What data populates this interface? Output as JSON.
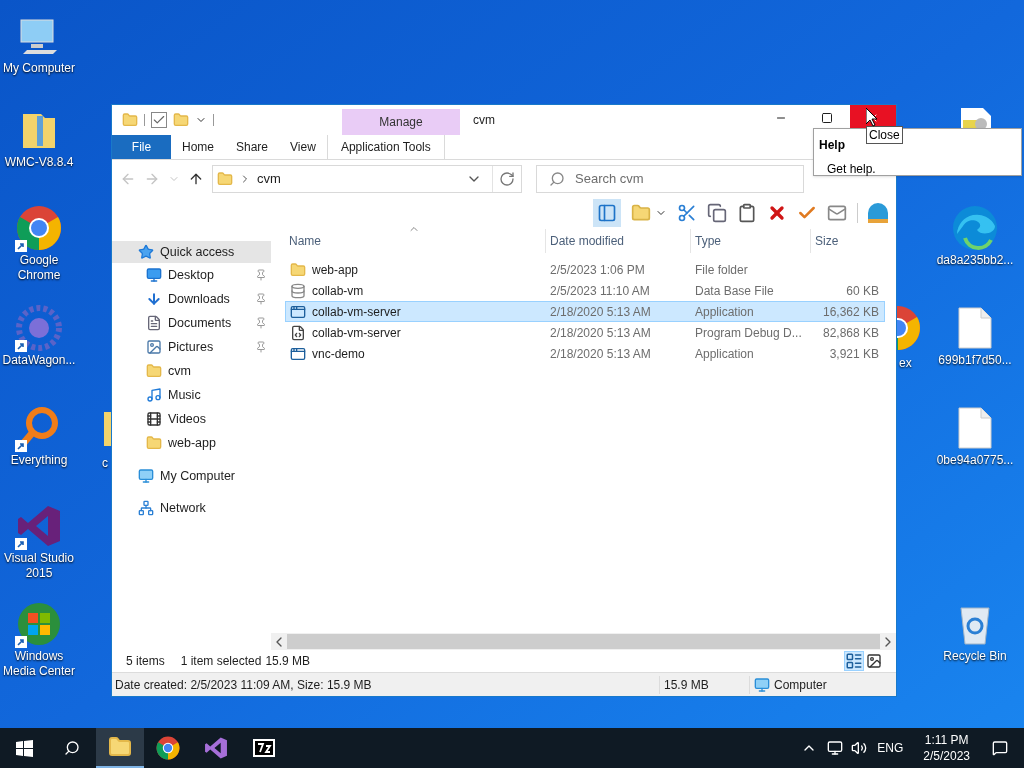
{
  "desktop": {
    "icons": [
      {
        "label": "My Computer",
        "kind": "computer",
        "shortcut": false
      },
      {
        "label": "WMC-V8.8.4",
        "kind": "zipfolder",
        "shortcut": false
      },
      {
        "label": "Google Chrome",
        "kind": "chrome",
        "shortcut": true
      },
      {
        "label": "DataWagon...",
        "kind": "gear",
        "shortcut": true
      },
      {
        "label": "Everything",
        "kind": "everything",
        "shortcut": true
      },
      {
        "label": "Visual Studio 2015",
        "kind": "vs",
        "shortcut": true
      },
      {
        "label": "Windows Media Center",
        "kind": "wmc",
        "shortcut": true
      },
      {
        "kind": "notes"
      },
      {
        "label": "da8a235bb2...",
        "kind": "edge",
        "shortcut": false
      },
      {
        "label": "699b1f7d50...",
        "kind": "file",
        "shortcut": false
      },
      {
        "label": "0be94a0775...",
        "kind": "file",
        "shortcut": false
      },
      {
        "label": "Recycle Bin",
        "kind": "recycle",
        "shortcut": false
      },
      {
        "label": "ex",
        "kind": "chrome",
        "shortcut": false
      },
      {
        "label": "c",
        "kind": "folder",
        "shortcut": false
      }
    ]
  },
  "window": {
    "title": "cvm",
    "context_group": "Manage",
    "tabs": [
      {
        "label": "File",
        "kind": "file",
        "selected": false
      },
      {
        "label": "Home",
        "kind": "plain",
        "selected": false
      },
      {
        "label": "Share",
        "kind": "plain",
        "selected": false
      },
      {
        "label": "View",
        "kind": "plain",
        "selected": false
      },
      {
        "label": "Application Tools",
        "kind": "context",
        "selected": false
      }
    ],
    "address": {
      "path": "cvm"
    },
    "search": {
      "placeholder": "Search cvm"
    },
    "nav": [
      {
        "label": "Quick access",
        "kind": "star",
        "selected": true,
        "children": [
          {
            "label": "Desktop",
            "kind": "desktop",
            "pinned": true,
            "selected": false
          },
          {
            "label": "Downloads",
            "kind": "downloads",
            "pinned": true,
            "selected": false
          },
          {
            "label": "Documents",
            "kind": "documents",
            "pinned": true,
            "selected": false
          },
          {
            "label": "Pictures",
            "kind": "pictures",
            "pinned": true,
            "selected": false
          },
          {
            "label": "cvm",
            "kind": "folder",
            "pinned": false,
            "selected": false
          },
          {
            "label": "Music",
            "kind": "music",
            "pinned": false,
            "selected": false
          },
          {
            "label": "Videos",
            "kind": "videos",
            "pinned": false,
            "selected": false
          },
          {
            "label": "web-app",
            "kind": "folder",
            "pinned": false,
            "selected": false
          }
        ]
      },
      {
        "label": "My Computer",
        "kind": "computer",
        "selected": false
      },
      {
        "label": "Network",
        "kind": "network",
        "selected": false
      }
    ],
    "columns": [
      "Name",
      "Date modified",
      "Type",
      "Size"
    ],
    "rows": [
      {
        "name": "web-app",
        "kind": "folder",
        "date": "2/5/2023 1:06 PM",
        "type": "File folder",
        "selected": false
      },
      {
        "name": "collab-vm",
        "kind": "db",
        "date": "2/5/2023 11:10 AM",
        "type": "Data Base File",
        "size": "60 KB",
        "selected": false
      },
      {
        "name": "collab-vm-server",
        "kind": "app",
        "date": "2/18/2020 5:13 AM",
        "type": "Application",
        "size": "16,362 KB",
        "selected": true
      },
      {
        "name": "collab-vm-server",
        "kind": "pdb",
        "date": "2/18/2020 5:13 AM",
        "type": "Program Debug D...",
        "size": "82,868 KB",
        "selected": false
      },
      {
        "name": "vnc-demo",
        "kind": "app",
        "date": "2/18/2020 5:13 AM",
        "type": "Application",
        "size": "3,921 KB",
        "selected": false
      }
    ],
    "status": {
      "items": "5 items",
      "selected": "1 item selected",
      "size": "15.9 MB"
    },
    "details_bar": {
      "info": "Date created: 2/5/2023 11:09 AM, Size: 15.9 MB",
      "size": "15.9 MB",
      "location": "Computer"
    }
  },
  "tooltip": "Close",
  "help_tip": {
    "title": "Help",
    "text": "Get help."
  },
  "taskbar": {
    "apps": [
      {
        "kind": "explorer",
        "active": true
      },
      {
        "kind": "chrome",
        "active": false
      },
      {
        "kind": "vs",
        "active": false
      },
      {
        "kind": "sevenzip",
        "active": false
      }
    ],
    "language": "ENG",
    "time": "1:11 PM",
    "date": "2/5/2023"
  }
}
